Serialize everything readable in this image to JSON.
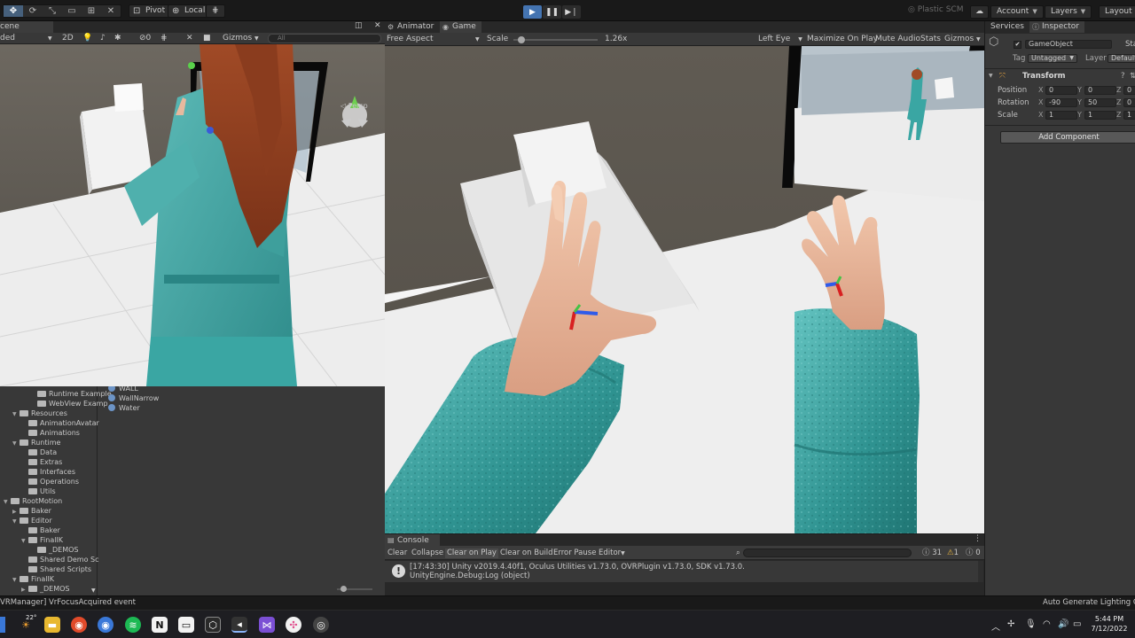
{
  "toolbar": {
    "pivot_label": "Pivot",
    "local_label": "Local",
    "plastic_label": "Plastic SCM",
    "account_label": "Account",
    "layers_label": "Layers",
    "layout_label": "Layout"
  },
  "scene": {
    "tab_label": "cene",
    "shading_mode": "ded",
    "mode_2d": "2D",
    "gizmos_label": "Gizmos",
    "hidden_count": "0",
    "search_placeholder": "All",
    "persp_label": "Persp"
  },
  "game": {
    "animator_tab": "Animator",
    "game_tab": "Game",
    "aspect_label": "Free Aspect",
    "scale_label": "Scale",
    "scale_value": "1.26x",
    "scale_fraction": 0.05,
    "eye_label": "Left Eye",
    "maximize_label": "Maximize On Play",
    "mute_label": "Mute Audio",
    "stats_label": "Stats",
    "gizmos_label": "Gizmos"
  },
  "project": {
    "tree": [
      {
        "label": "Runtime Example",
        "depth": 2,
        "arrow": ""
      },
      {
        "label": "WebView Examp",
        "depth": 2,
        "arrow": ""
      },
      {
        "label": "Resources",
        "depth": 0,
        "arrow": "▼"
      },
      {
        "label": "AnimationAvatar",
        "depth": 1,
        "arrow": ""
      },
      {
        "label": "Animations",
        "depth": 1,
        "arrow": ""
      },
      {
        "label": "Runtime",
        "depth": 0,
        "arrow": "▼"
      },
      {
        "label": "Data",
        "depth": 1,
        "arrow": ""
      },
      {
        "label": "Extras",
        "depth": 1,
        "arrow": ""
      },
      {
        "label": "Interfaces",
        "depth": 1,
        "arrow": ""
      },
      {
        "label": "Operations",
        "depth": 1,
        "arrow": ""
      },
      {
        "label": "Utils",
        "depth": 1,
        "arrow": ""
      },
      {
        "label": "RootMotion",
        "depth": -1,
        "arrow": "▼"
      },
      {
        "label": "Baker",
        "depth": 0,
        "arrow": "▶"
      },
      {
        "label": "Editor",
        "depth": 0,
        "arrow": "▼"
      },
      {
        "label": "Baker",
        "depth": 1,
        "arrow": ""
      },
      {
        "label": "FinalIK",
        "depth": 1,
        "arrow": "▼"
      },
      {
        "label": "_DEMOS",
        "depth": 2,
        "arrow": ""
      },
      {
        "label": "Shared Demo Sc",
        "depth": 1,
        "arrow": ""
      },
      {
        "label": "Shared Scripts",
        "depth": 1,
        "arrow": ""
      },
      {
        "label": "FinalIK",
        "depth": 0,
        "arrow": "▼"
      },
      {
        "label": "_DEMOS",
        "depth": 1,
        "arrow": "▶"
      }
    ],
    "assets": [
      "WALL",
      "WallNarrow",
      "Water"
    ]
  },
  "console": {
    "tab_label": "Console",
    "clear_label": "Clear",
    "collapse_label": "Collapse",
    "clear_on_play_label": "Clear on Play",
    "clear_on_build_label": "Clear on Build",
    "error_pause_label": "Error Pause",
    "editor_label": "Editor",
    "info_count": "31",
    "warning_count": "1",
    "error_count": "0",
    "entry_line1": "[17:43:30] Unity v2019.4.40f1, Oculus Utilities v1.73.0, OVRPlugin v1.73.0, SDK v1.73.0.",
    "entry_line2": "UnityEngine.Debug:Log (object)"
  },
  "inspector": {
    "services_tab": "Services",
    "inspector_tab": "Inspector",
    "object_name": "GameObject",
    "static_label": "Sta",
    "tag_label": "Tag",
    "tag_value": "Untagged",
    "layer_label": "Layer",
    "layer_value": "Default",
    "transform_label": "Transform",
    "position_label": "Position",
    "rotation_label": "Rotation",
    "scale_label": "Scale",
    "pos_x": "0",
    "pos_y": "0",
    "pos_z": "0",
    "rot_x": "-90",
    "rot_y": "50",
    "rot_z": "0",
    "scl_x": "1",
    "scl_y": "1",
    "scl_z": "1",
    "add_component_label": "Add Component"
  },
  "status": {
    "message": "VRManager] VrFocusAcquired event",
    "lighting_label": "Auto Generate Lighting Off"
  },
  "taskbar": {
    "time": "5:44 PM",
    "date": "7/12/2022",
    "weather_temp": "22°"
  },
  "colors": {
    "play_active": "#4474b1",
    "editor_bg": "#383838",
    "toolbar_bg": "#191919",
    "outfit_teal": "#3a9a9a",
    "floor": "#ececec"
  }
}
